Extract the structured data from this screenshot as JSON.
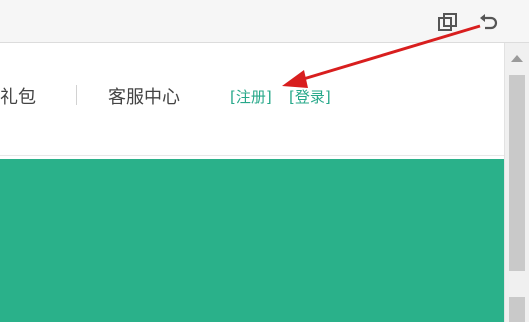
{
  "toolbar": {
    "icons": [
      "restore-window-icon",
      "undo-icon"
    ]
  },
  "nav": {
    "gift_label": "礼包",
    "service_label": "客服中心",
    "register_label": "[注册]",
    "login_label": "[登录]"
  },
  "colors": {
    "brand_green": "#2ab18a",
    "link_green": "#27a88a",
    "annotation_red": "#d81e1e"
  }
}
